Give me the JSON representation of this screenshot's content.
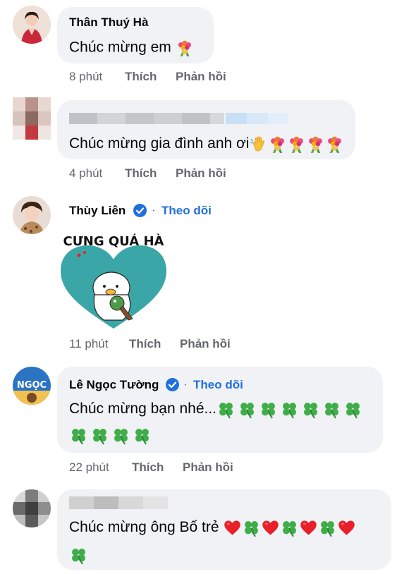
{
  "comments": [
    {
      "author": "Thân Thuý Hà",
      "text": "Chúc mừng em",
      "time": "8 phút",
      "like": "Thích",
      "reply": "Phản hồi"
    },
    {
      "author": "",
      "text": "Chúc mừng gia đình anh ơi",
      "time": "4 phút",
      "like": "Thích",
      "reply": "Phản hồi"
    },
    {
      "author": "Thùy Liên",
      "follow": "Theo dõi",
      "sticker_text": "CƯNG QUÁ HÀ",
      "time": "11 phút",
      "like": "Thích",
      "reply": "Phản hồi"
    },
    {
      "author": "Lê Ngọc Tường",
      "follow": "Theo dõi",
      "text": "Chúc mừng bạn nhé...",
      "time": "22 phút",
      "like": "Thích",
      "reply": "Phản hồi"
    },
    {
      "author": "",
      "text": "Chúc mừng ông Bố trẻ"
    }
  ],
  "icons": {
    "bouquet": "bouquet-icon",
    "wave": "waving-hand-icon",
    "clover": "four-leaf-clover-icon",
    "heart": "red-heart-icon",
    "verified": "verified-badge-icon"
  },
  "colors": {
    "bubble": "#f0f2f5",
    "link_blue": "#216fdb",
    "meta_gray": "#65676b",
    "sticker_teal": "#3aa6a8",
    "heart_red": "#e8202a",
    "clover_green": "#3fae49"
  }
}
